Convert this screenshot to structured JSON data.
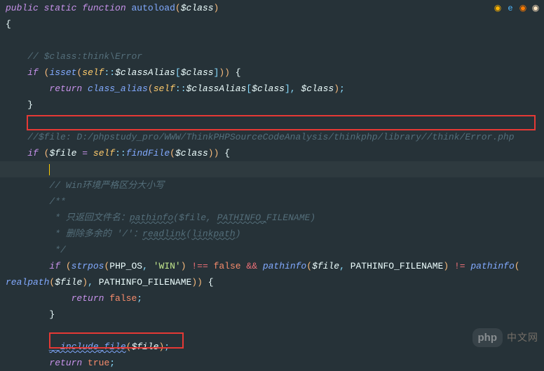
{
  "code": {
    "l1_public": "public",
    "l1_static": "static",
    "l1_function": "function",
    "l1_fnname": "autoload",
    "l1_var": "$class",
    "l2_brace": "{",
    "l3_comment": "// $class:think\\Error",
    "l4_if": "if",
    "l4_isset": "isset",
    "l4_self": "self",
    "l4_scope": "::",
    "l4_classalias": "$classAlias",
    "l4_class": "$class",
    "l5_return": "return",
    "l5_classalias_fn": "class_alias",
    "l5_self": "self",
    "l5_scope": "::",
    "l5_classalias": "$classAlias",
    "l5_class1": "$class",
    "l5_class2": "$class",
    "l6_brace": "}",
    "l7_comment": "//$file: D:/phpstudy_pro/WWW/ThinkPHPSourceCodeAnalysis/thinkphp/library//think/Error.php",
    "l8_if": "if",
    "l8_file": "$file",
    "l8_self": "self",
    "l8_scope": "::",
    "l8_findfile": "findFile",
    "l8_class": "$class",
    "l10_comment": "// Win环境严格区分大小写",
    "l11_comment": "/**",
    "l12_star": " * 只返回文件名：",
    "l12_pathinfo": "pathinfo",
    "l12_file": "($file, ",
    "l12_const": "PATHINFO_",
    "l12_const2": "FILENAME)",
    "l13_star": " * 删除多余的 '/'：",
    "l13_readlink": "readlink",
    "l13_open": "(",
    "l13_linkpath": "linkpath",
    "l13_close": ")",
    "l14_comment": " */",
    "l15_if": "if",
    "l15_strpos": "strpos",
    "l15_phpos": "PHP_OS",
    "l15_win": "'WIN'",
    "l15_neq": "!==",
    "l15_false": "false",
    "l15_and": "&&",
    "l15_pathinfo": "pathinfo",
    "l15_file": "$file",
    "l15_pathconst": "PATHINFO_FILENAME",
    "l15_ne": "!=",
    "l15_pathinfo2": "pathinfo",
    "l16_realpath": "realpath",
    "l16_file": "$file",
    "l16_pathconst": "PATHINFO_FILENAME",
    "l17_return": "return",
    "l17_false": "false",
    "l18_brace": "}",
    "l20_include": "__include_file",
    "l20_file": "$file",
    "l21_return": "return",
    "l21_true": "true"
  },
  "watermark": {
    "badge": "php",
    "text": "中文网"
  }
}
